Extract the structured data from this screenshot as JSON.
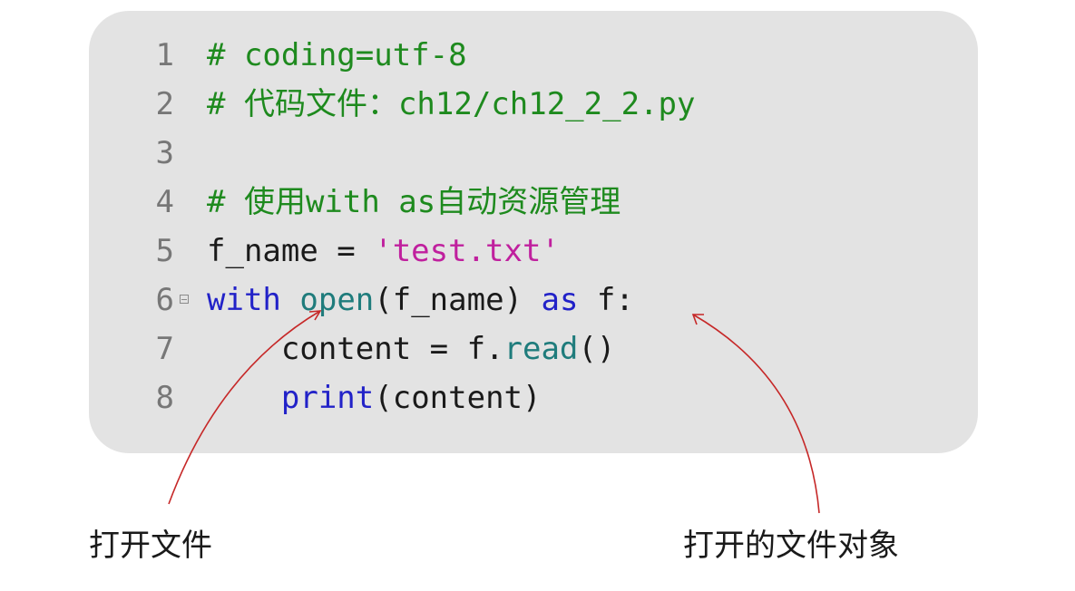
{
  "code_panel": {
    "lines": [
      {
        "num": "1",
        "segments": [
          {
            "t": "comment",
            "text": "# coding=utf-8"
          }
        ]
      },
      {
        "num": "2",
        "segments": [
          {
            "t": "comment",
            "text": "# 代码文件：ch12/ch12_2_2.py"
          }
        ]
      },
      {
        "num": "3",
        "segments": []
      },
      {
        "num": "4",
        "segments": [
          {
            "t": "comment",
            "text": "# 使用with as自动资源管理"
          }
        ]
      },
      {
        "num": "5",
        "segments": [
          {
            "t": "plain",
            "text": "f_name = "
          },
          {
            "t": "str",
            "text": "'test.txt'"
          }
        ]
      },
      {
        "num": "6",
        "fold": true,
        "segments": [
          {
            "t": "kw",
            "text": "with"
          },
          {
            "t": "plain",
            "text": " "
          },
          {
            "t": "fn",
            "text": "open"
          },
          {
            "t": "plain",
            "text": "(f_name) "
          },
          {
            "t": "kw",
            "text": "as"
          },
          {
            "t": "plain",
            "text": " f:"
          }
        ]
      },
      {
        "num": "7",
        "segments": [
          {
            "t": "plain",
            "text": "    content = f."
          },
          {
            "t": "fn",
            "text": "read"
          },
          {
            "t": "plain",
            "text": "()"
          }
        ]
      },
      {
        "num": "8",
        "segments": [
          {
            "t": "plain",
            "text": "    "
          },
          {
            "t": "kw",
            "text": "print"
          },
          {
            "t": "plain",
            "text": "(content)"
          }
        ]
      }
    ],
    "fold_icon": "minus-box-icon"
  },
  "callouts": {
    "left_label": "打开文件",
    "right_label": "打开的文件对象",
    "arrow_color": "#c62828"
  },
  "colors": {
    "panel_bg": "#e3e3e3",
    "comment": "#1e8a1e",
    "keyword": "#2222c8",
    "function": "#1f7c7c",
    "string": "#c0209e",
    "line_number": "#777777"
  }
}
